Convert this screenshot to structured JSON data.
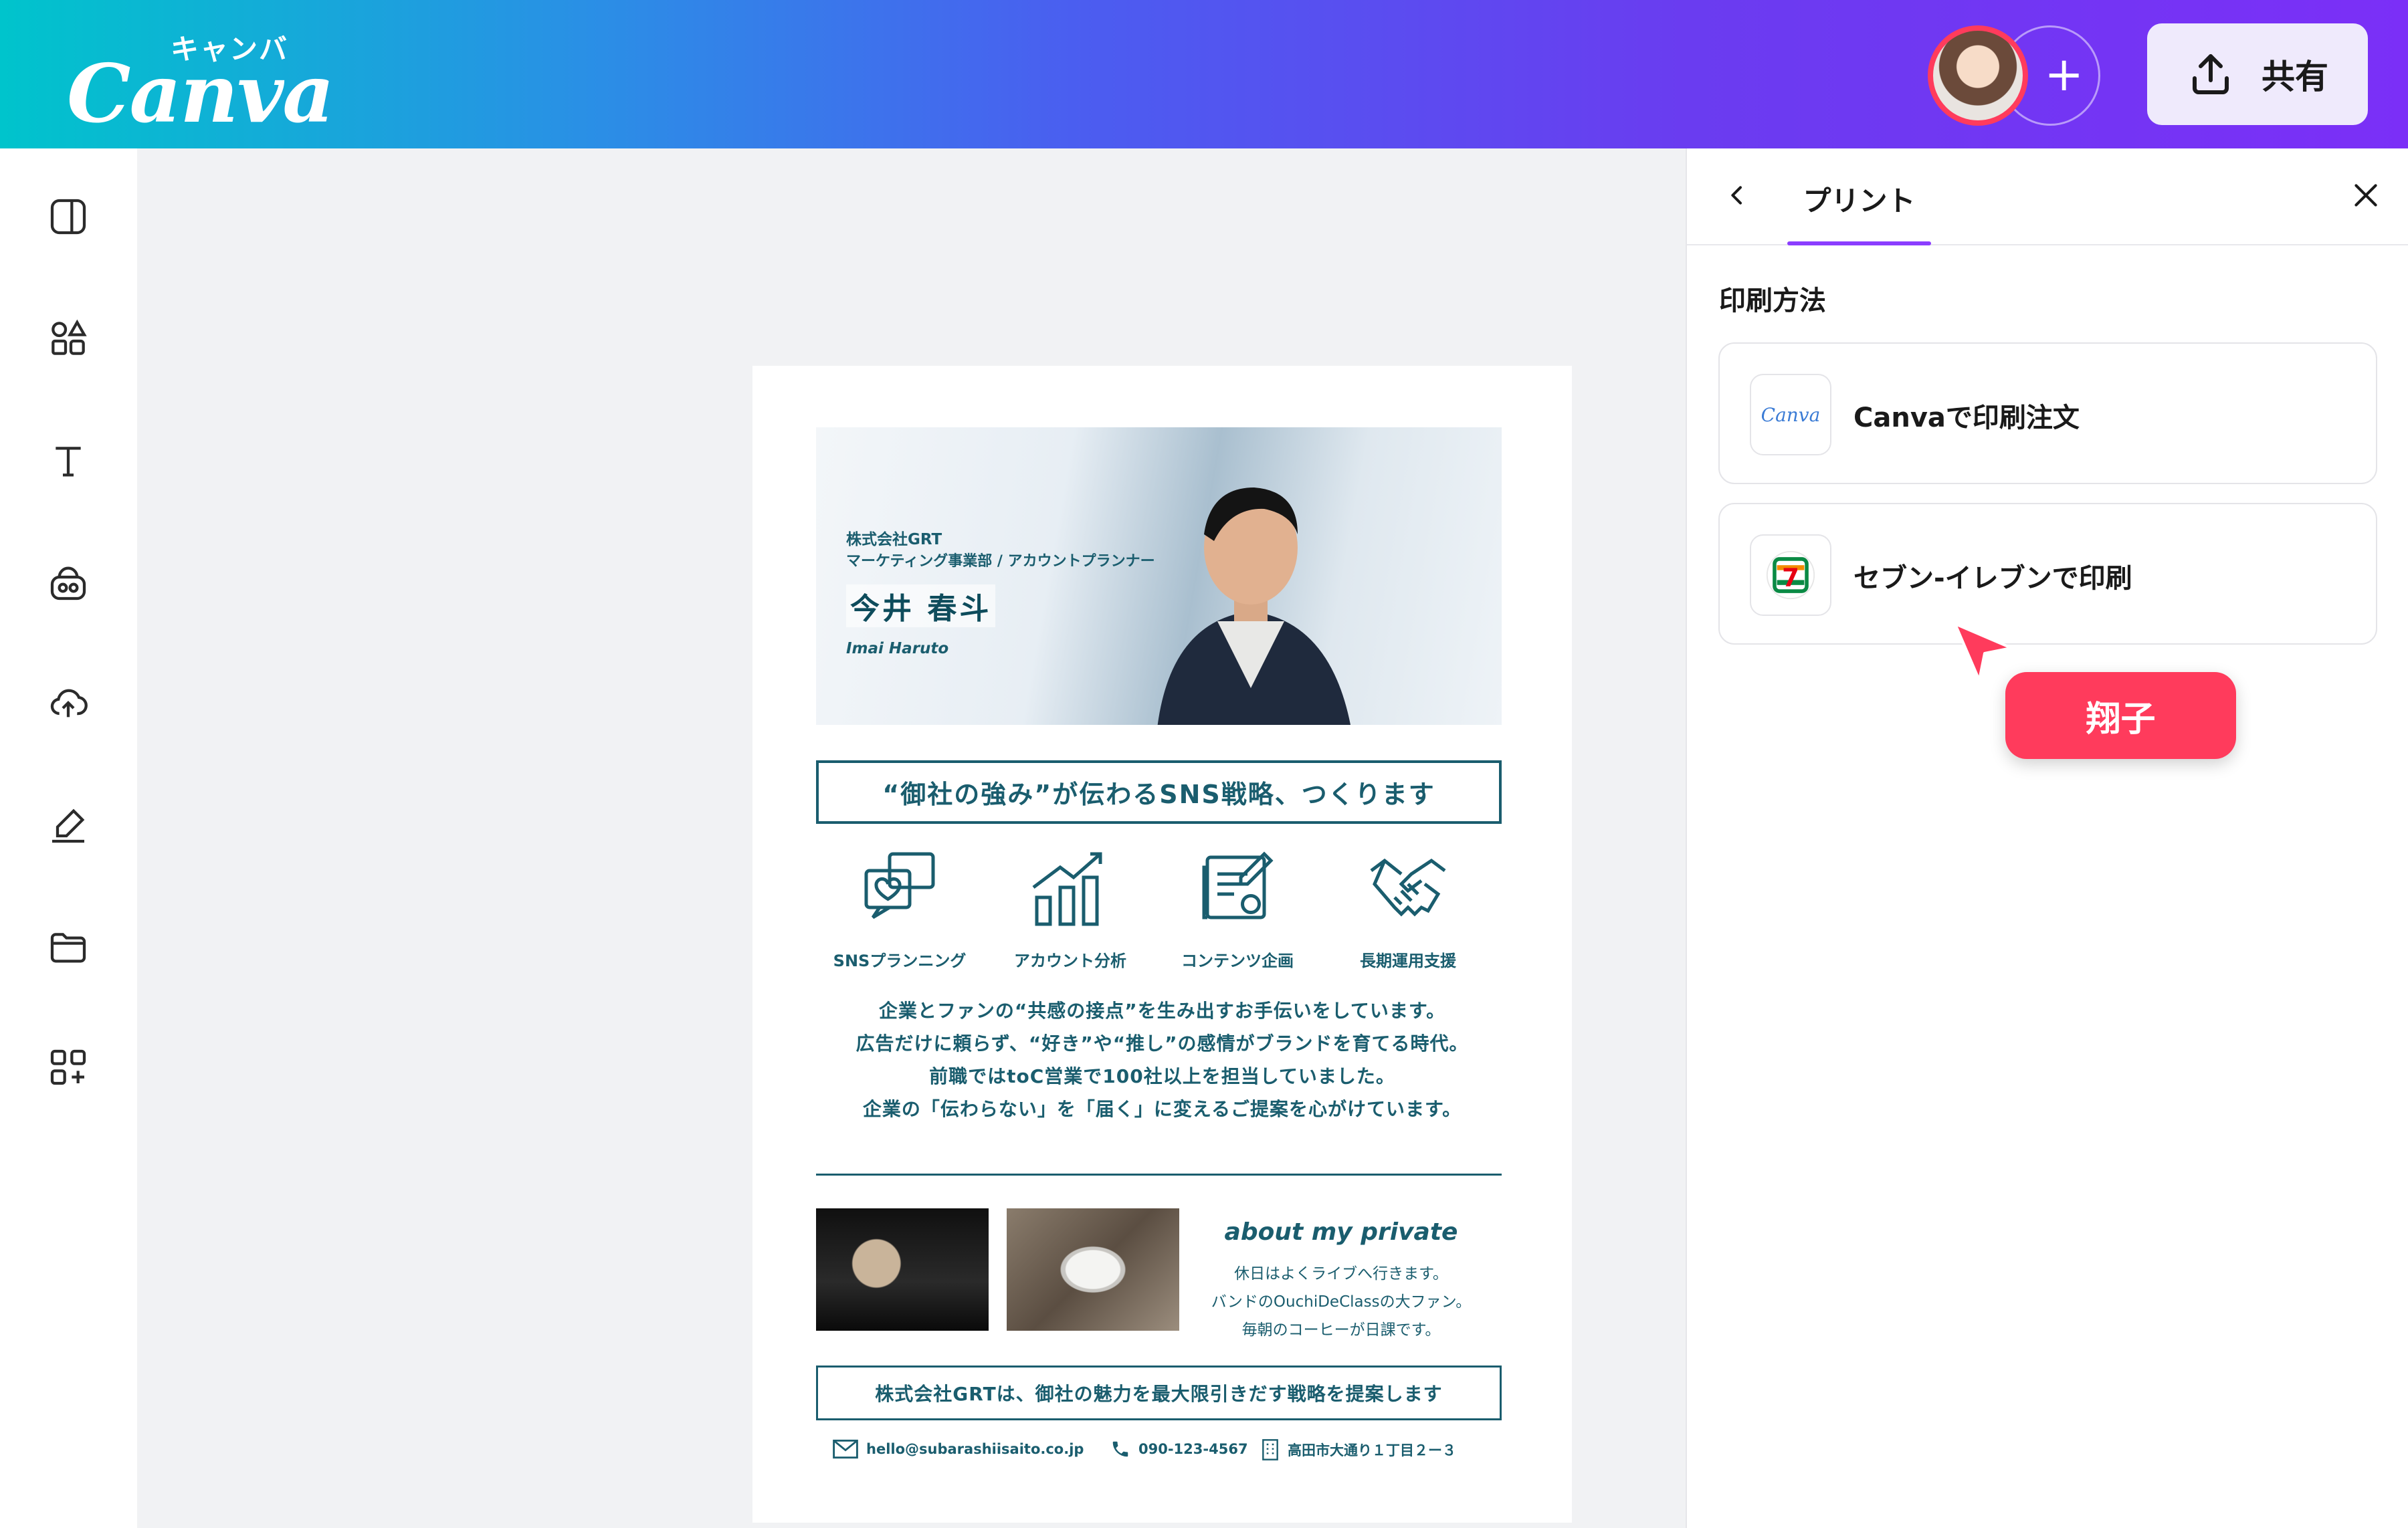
{
  "app": {
    "logo_kana": "キャンバ",
    "logo_word": "Canva",
    "share_label": "共有"
  },
  "page": {
    "hero": {
      "company": "株式会社GRT",
      "department": "マーケティング事業部 / アカウントプランナー",
      "name": "今井 春斗",
      "romaji": "Imai Haruto"
    },
    "tagline": "“御社の強み”が伝わるSNS戦略、つくります",
    "services": [
      {
        "label": "SNSプランニング",
        "icon": "chat-heart-icon"
      },
      {
        "label": "アカウント分析",
        "icon": "bar-chart-icon"
      },
      {
        "label": "コンテンツ企画",
        "icon": "planning-doc-icon"
      },
      {
        "label": "長期運用支援",
        "icon": "handshake-icon"
      }
    ],
    "intro": [
      "企業とファンの“共感の接点”を生み出すお手伝いをしています。",
      "広告だけに頼らず、“好き”や“推し”の感情がブランドを育てる時代。",
      "前職ではtoC営業で100社以上を担当していました。",
      "企業の「伝わらない」を「届く」に変えるご提案を心がけています。"
    ],
    "about_title": "about my private",
    "about_lines": [
      "休日はよくライブへ行きます。",
      "バンドのOuchiDeClassの大ファン。",
      "毎朝のコーヒーが日課です。"
    ],
    "closing": "株式会社GRTは、御社の魅力を最大限引きだす戦略を提案します",
    "contacts": {
      "email": "hello@subarashiisaito.co.jp",
      "phone": "090-123-4567",
      "address": "高田市大通り１丁目２ー３"
    }
  },
  "panel": {
    "tab": "プリント",
    "section_title": "印刷方法",
    "options": [
      {
        "label": "Canvaで印刷注文",
        "logo_text": "Canva"
      },
      {
        "label": "セブン-イレブンで印刷",
        "logo_text": "7"
      }
    ]
  },
  "collaborator": {
    "name": "翔子",
    "color": "#ff3b5c"
  },
  "colors": {
    "accent": "#8b3dff",
    "doc_teal": "#1a5d6e"
  }
}
